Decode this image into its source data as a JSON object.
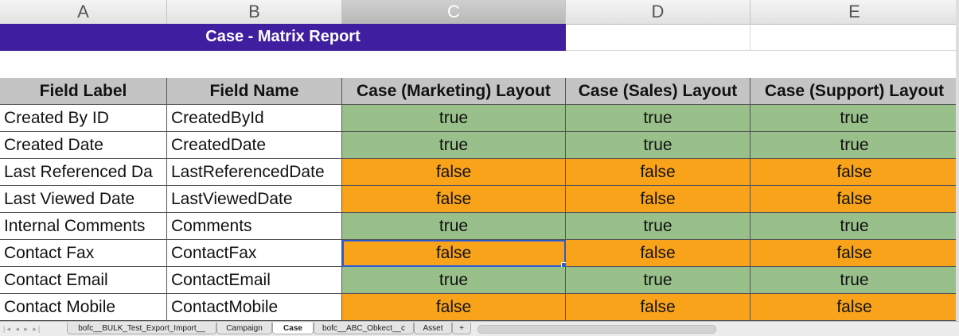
{
  "columns": [
    "A",
    "B",
    "C",
    "D",
    "E"
  ],
  "report_title": "Case - Matrix Report",
  "table": {
    "headers": [
      "Field Label",
      "Field Name",
      "Case (Marketing) Layout",
      "Case (Sales) Layout",
      "Case (Support) Layout"
    ],
    "rows": [
      {
        "label": "Created By ID",
        "name": "CreatedById",
        "marketing": "true",
        "sales": "true",
        "support": "true"
      },
      {
        "label": "Created Date",
        "name": "CreatedDate",
        "marketing": "true",
        "sales": "true",
        "support": "true"
      },
      {
        "label": "Last Referenced Da",
        "name": "LastReferencedDate",
        "marketing": "false",
        "sales": "false",
        "support": "false"
      },
      {
        "label": "Last Viewed Date",
        "name": "LastViewedDate",
        "marketing": "false",
        "sales": "false",
        "support": "false"
      },
      {
        "label": "Internal Comments",
        "name": "Comments",
        "marketing": "true",
        "sales": "true",
        "support": "true"
      },
      {
        "label": "Contact Fax",
        "name": "ContactFax",
        "marketing": "false",
        "sales": "false",
        "support": "false"
      },
      {
        "label": "Contact Email",
        "name": "ContactEmail",
        "marketing": "true",
        "sales": "true",
        "support": "true"
      },
      {
        "label": "Contact Mobile",
        "name": "ContactMobile",
        "marketing": "false",
        "sales": "false",
        "support": "false"
      }
    ]
  },
  "sheet_tabs": [
    {
      "label": "bofc__BULK_Test_Export_Import__",
      "active": false
    },
    {
      "label": "Campaign",
      "active": false
    },
    {
      "label": "Case",
      "active": true
    },
    {
      "label": "bofc__ABC_Obkect__c",
      "active": false
    },
    {
      "label": "Asset",
      "active": false
    }
  ],
  "nav_arrows": "|◂ ◂ ▸ ▸|",
  "add_sheet_label": "+",
  "colors": {
    "title_bg": "#3f1fa0",
    "true_bg": "#99c08a",
    "false_bg": "#f9a31a",
    "header_bg": "#c4c4c4",
    "selection": "#2c5bd6"
  },
  "selected_column": "C",
  "active_cell": {
    "row": 6,
    "column": "C"
  }
}
